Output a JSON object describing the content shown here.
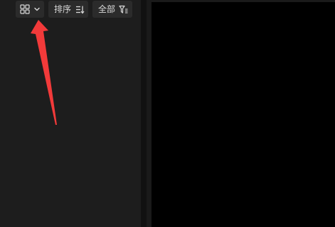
{
  "toolbar": {
    "view_toggle": {
      "icon": "grid-view-icon",
      "dropdown_icon": "chevron-down-icon"
    },
    "sort_button": {
      "label": "排序",
      "icon": "sort-icon"
    },
    "filter_button": {
      "label": "全部",
      "icon": "filter-icon"
    }
  },
  "annotation": {
    "type": "arrow",
    "color": "#f23a3a",
    "points_to": "view-toggle-button"
  },
  "colors": {
    "panel": "#1d1d1d",
    "button": "#2b2b2b",
    "text": "#d9d9d9",
    "preview": "#000000"
  }
}
